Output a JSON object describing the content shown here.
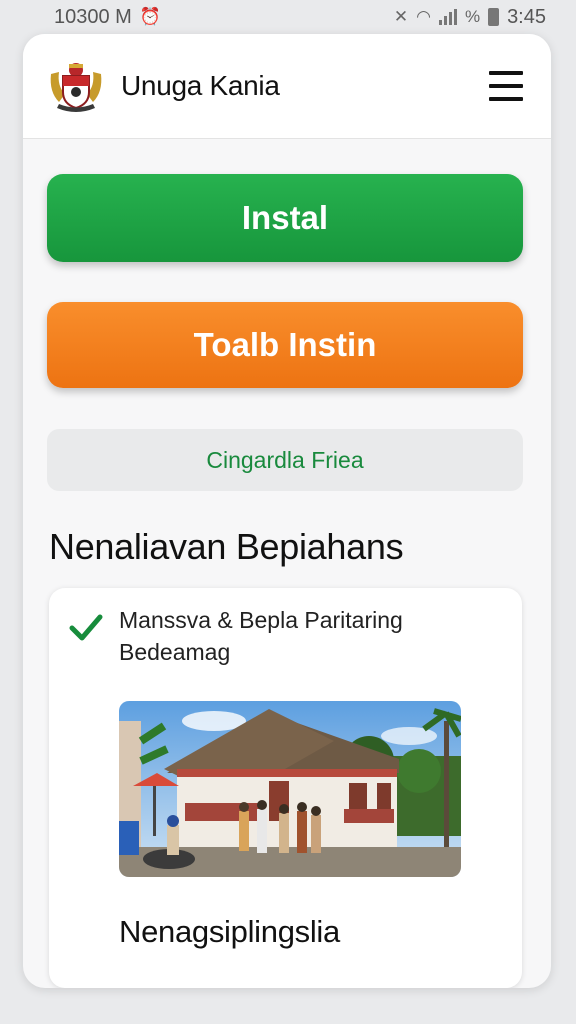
{
  "status_bar": {
    "time_left": "10300 M",
    "time_right": "3:45",
    "icons": [
      "alarm-icon",
      "mute-icon",
      "wifi-icon",
      "signal-icon",
      "data-icon",
      "battery-icon"
    ]
  },
  "header": {
    "title": "Unuga Kania",
    "logo_icon": "coat-of-arms-logo",
    "menu_icon": "hamburger-menu-icon"
  },
  "buttons": {
    "primary_label": "Instal",
    "secondary_label": "Toalb Instin",
    "tertiary_label": "Cingardla Friea"
  },
  "section": {
    "title": "Nenaliavan Bepiahans",
    "feature_text": "Manssva & Bepla Paritaring Bedeamag",
    "feature_icon": "check-icon",
    "image_subject": "house-photo",
    "caption": "Nenagsiplingslia"
  },
  "colors": {
    "primary_green": "#1ea446",
    "secondary_orange": "#f27b18",
    "link_green": "#198a3d",
    "card_bg": "#ffffff"
  }
}
